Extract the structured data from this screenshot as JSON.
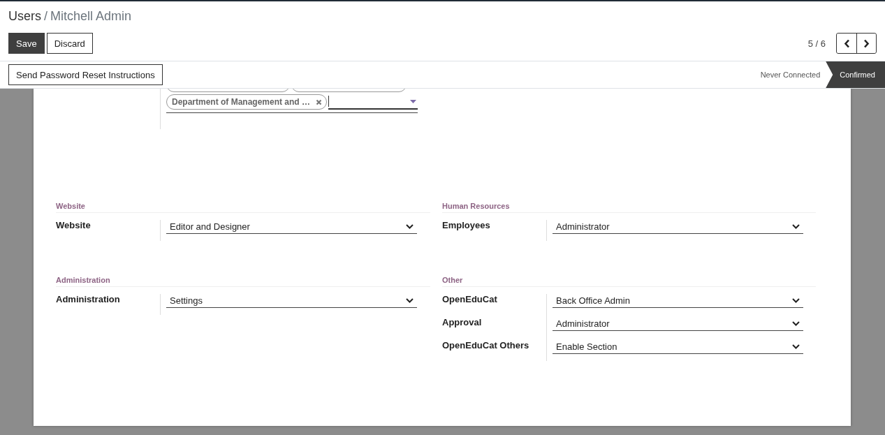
{
  "breadcrumb": [
    {
      "label": "Users"
    },
    {
      "label": "Mitchell Admin"
    }
  ],
  "breadcrumb_separator": "/",
  "buttons": [
    {
      "label": "Save",
      "kind": "primary"
    },
    {
      "label": "Discard",
      "kind": "secondary"
    }
  ],
  "pager": {
    "text": "5 / 6"
  },
  "action_button": {
    "label": "Send Password Reset Instructions"
  },
  "statuses": [
    {
      "label": "Never Connected",
      "selected": false
    },
    {
      "label": "Confirmed",
      "selected": true
    }
  ],
  "tags": [
    {
      "kind": "cut"
    },
    {
      "kind": "cut"
    },
    {
      "kind": "full",
      "label": "Department of Management and …"
    }
  ],
  "sections": [
    {
      "title": "Website",
      "fields": [
        {
          "label": "Website",
          "value": "Editor and Designer"
        }
      ]
    },
    {
      "title": "Human Resources",
      "fields": [
        {
          "label": "Employees",
          "value": "Administrator"
        }
      ]
    },
    {
      "title": "Administration",
      "fields": [
        {
          "label": "Administration",
          "value": "Settings"
        }
      ]
    },
    {
      "title": "Other",
      "fields": [
        {
          "label": "OpenEduCat",
          "value": "Back Office Admin"
        },
        {
          "label": "Approval",
          "value": "Administrator"
        },
        {
          "label": "OpenEduCat Others",
          "value": "Enable Section"
        }
      ]
    }
  ]
}
